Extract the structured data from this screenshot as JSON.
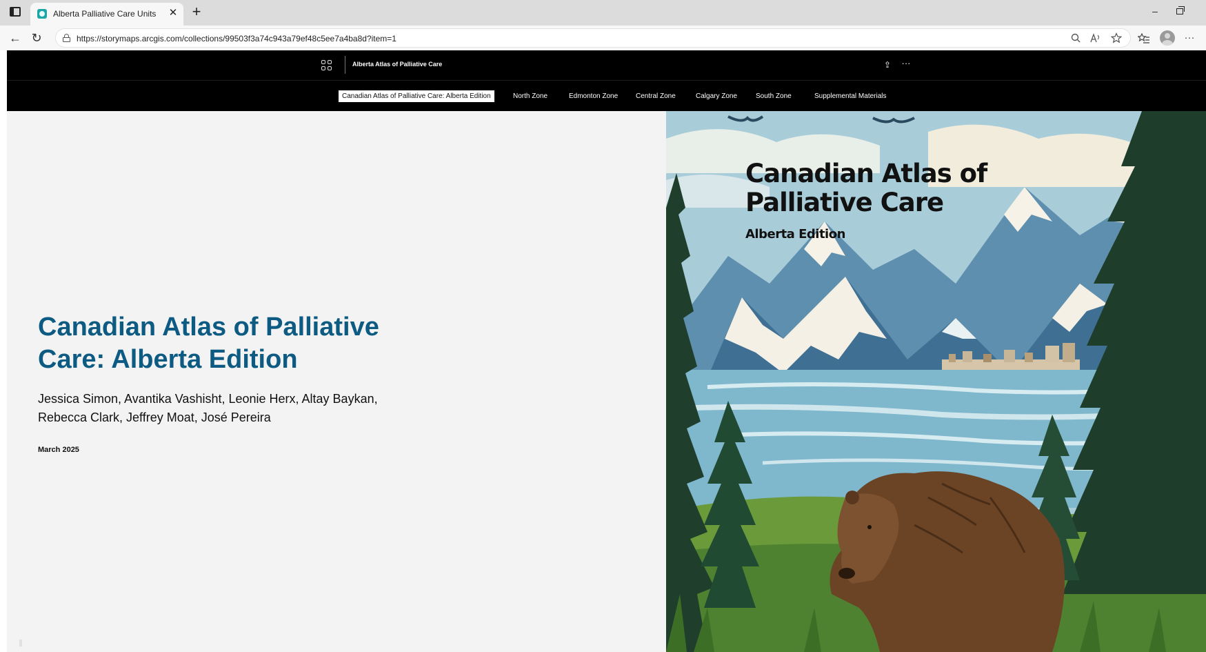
{
  "browser": {
    "tab_title": "Alberta Palliative Care Units",
    "tab_close": "✕",
    "new_tab": "+",
    "url": "https://storymaps.arcgis.com/collections/99503f3a74c943a79ef48c5ee7a4ba8d?item=1",
    "minimize": "–"
  },
  "header": {
    "collection_title": "Alberta Atlas of Palliative Care",
    "share_icon": "share-icon",
    "more_icon": "more-icon"
  },
  "nav": {
    "items": [
      {
        "label": "Canadian Atlas of Palliative Care: Alberta Edition",
        "active": true
      },
      {
        "label": "North Zone"
      },
      {
        "label": "Edmonton Zone"
      },
      {
        "label": "Central Zone"
      },
      {
        "label": "Calgary Zone"
      },
      {
        "label": "South Zone"
      },
      {
        "label": "Supplemental Materials"
      }
    ]
  },
  "content": {
    "title": "Canadian Atlas of Palliative Care: Alberta Edition",
    "authors": "Jessica Simon, Avantika Vashisht, Leonie Herx, Altay Baykan, Rebecca Clark, Jeffrey Moat, José Pereira",
    "date": "March 2025"
  },
  "cover": {
    "title_line1": "Canadian Atlas of",
    "title_line2": "Palliative Care",
    "subtitle": "Alberta Edition"
  },
  "colors": {
    "title_blue": "#0d5b82",
    "panel_bg": "#f3f3f3",
    "header_bg": "#000000"
  }
}
